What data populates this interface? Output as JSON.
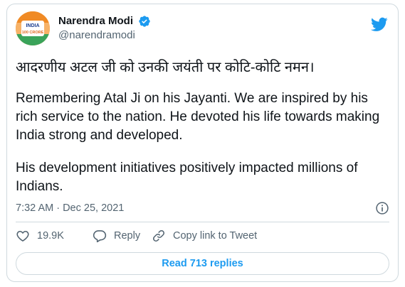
{
  "user": {
    "display_name": "Narendra Modi",
    "handle": "@narendramodi",
    "avatar_badge_text": "INDIA",
    "avatar_badge_sub": "100 CRORE"
  },
  "tweet": {
    "hindi_line": "आदरणीय अटल जी को उनकी जयंती पर कोटि-कोटि नमन।",
    "paragraph_1": "Remembering Atal Ji on his Jayanti. We are inspired by his rich service to the nation. He devoted his life towards making India strong and developed.",
    "paragraph_2": "His development initiatives positively impacted millions of Indians.",
    "timestamp": "7:32 AM · Dec 25, 2021"
  },
  "actions": {
    "like_count": "19.9K",
    "reply_label": "Reply",
    "copy_label": "Copy link to Tweet"
  },
  "footer": {
    "read_replies_label": "Read 713 replies"
  },
  "colors": {
    "twitter_blue": "#1d9bf0",
    "text": "#0f1419",
    "muted": "#536471",
    "border": "#cfd9de"
  },
  "icons": [
    "verified-badge-icon",
    "twitter-bird-icon",
    "info-icon",
    "heart-icon",
    "reply-icon",
    "link-icon"
  ]
}
